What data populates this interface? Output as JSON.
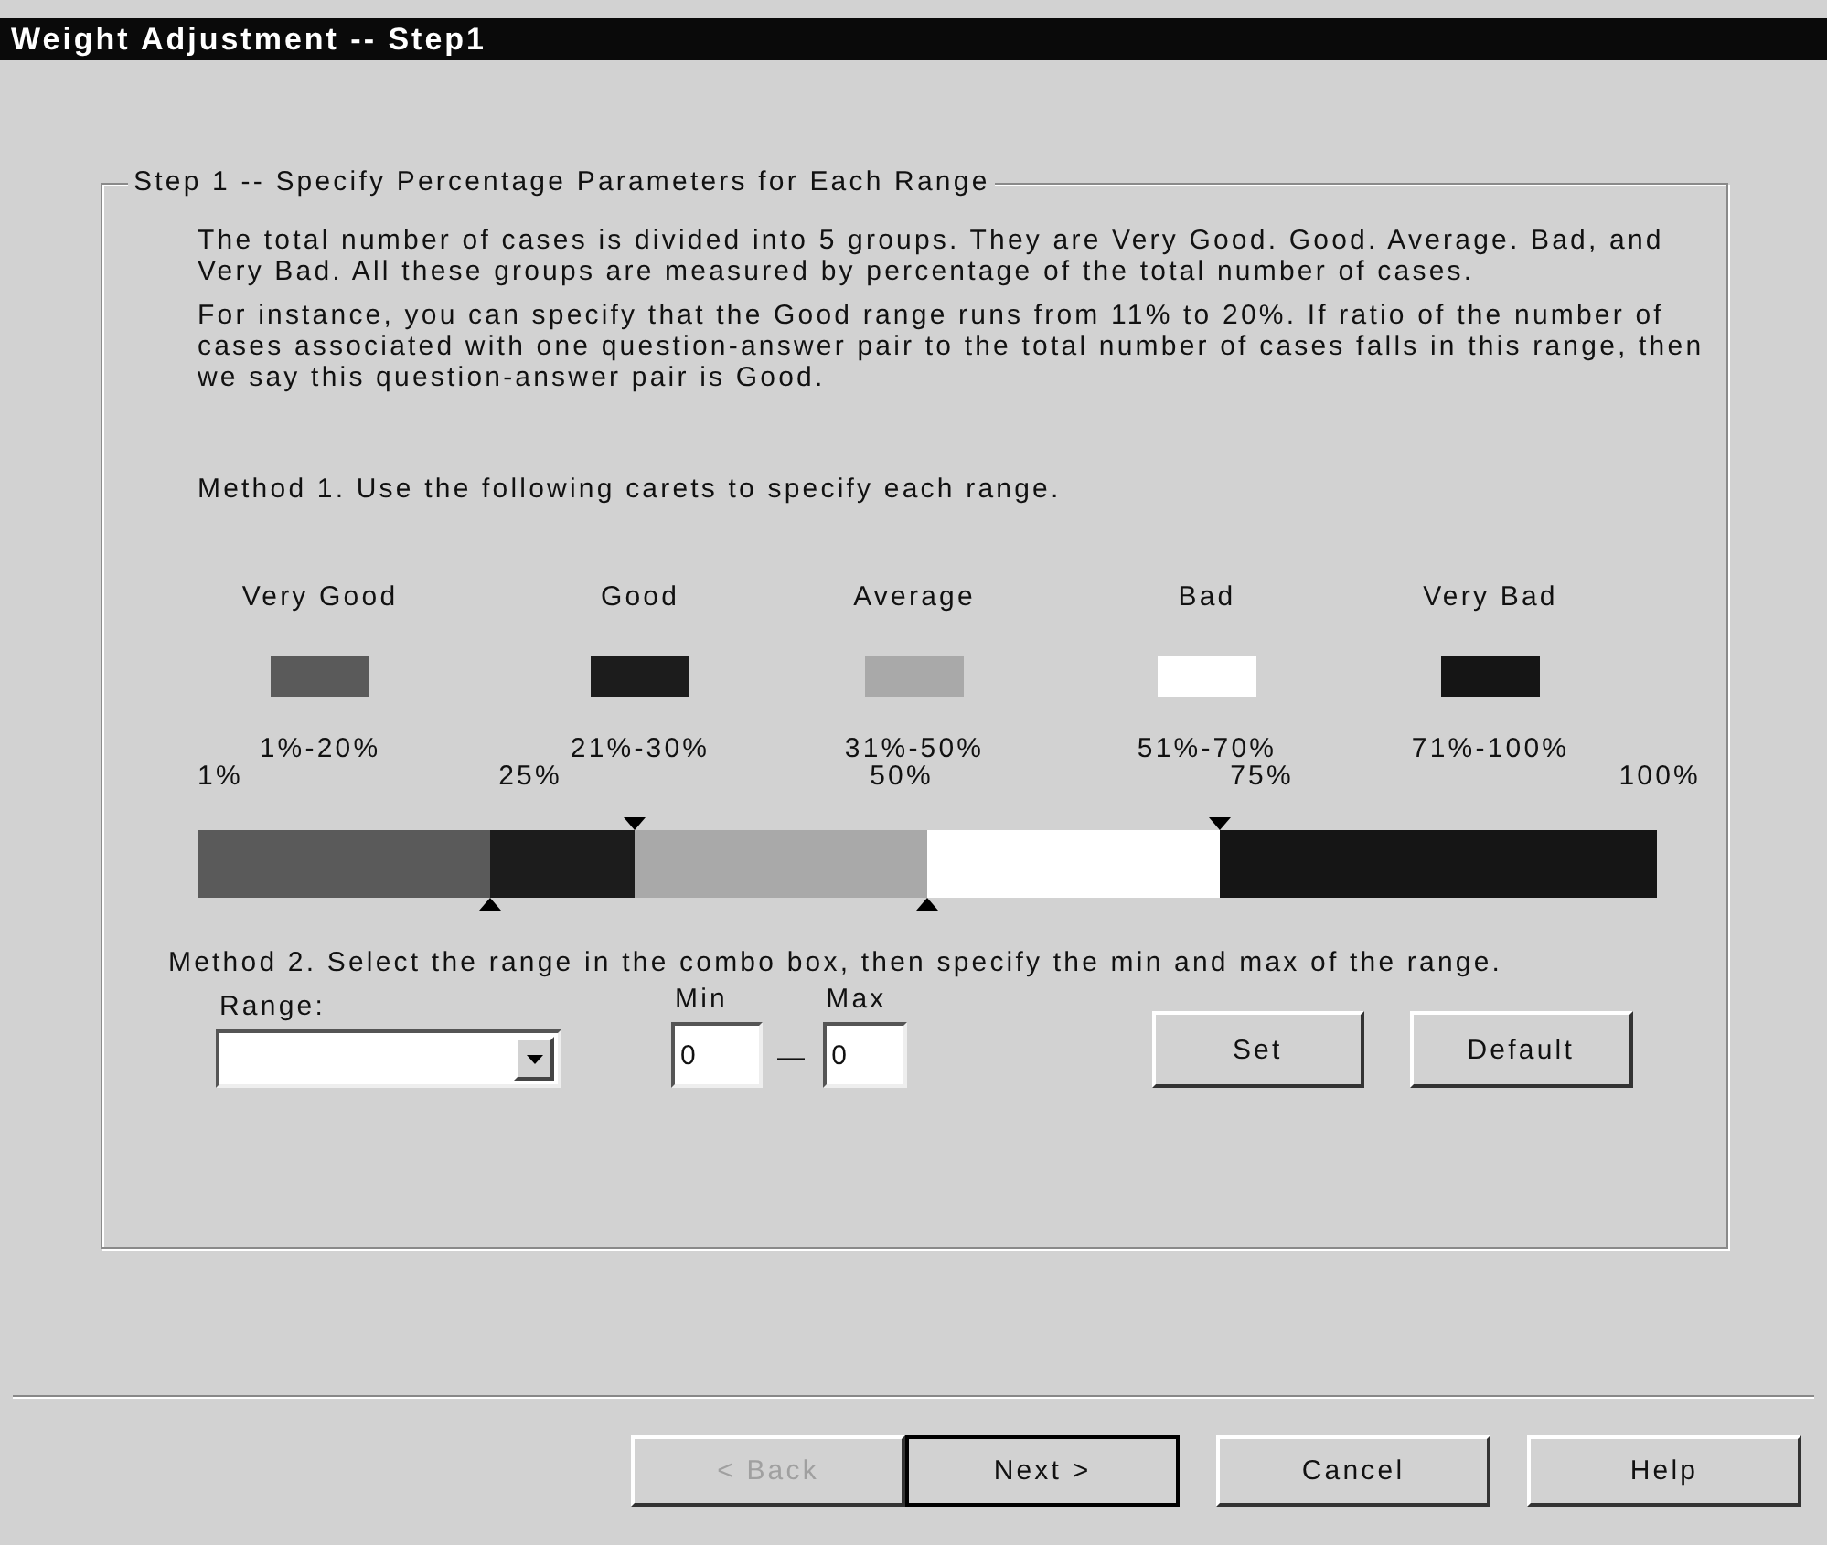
{
  "window": {
    "title": "Weight Adjustment -- Step1"
  },
  "group": {
    "title": "Step 1 -- Specify Percentage Parameters for Each Range",
    "paragraphs": [
      "The total number of cases is divided into 5 groups. They are Very Good. Good. Average. Bad, and Very Bad. All these groups are measured by percentage of the total number of cases.",
      "For instance, you can specify that the Good range runs from 11% to 20%. If ratio of the number of cases associated with one question-answer pair to the total  number of cases falls in this range, then we say this question-answer pair is Good."
    ],
    "method1": "Method 1. Use the following carets to specify each range.",
    "ranges": [
      {
        "label": "Very Good",
        "color": "#5a5a5a",
        "range": "1%-20%"
      },
      {
        "label": "Good",
        "color": "#1c1c1c",
        "range": "21%-30%"
      },
      {
        "label": "Average",
        "color": "#a9a9a9",
        "range": "31%-50%"
      },
      {
        "label": "Bad",
        "color": "#ffffff",
        "range": "51%-70%"
      },
      {
        "label": "Very Bad",
        "color": "#151515",
        "range": "71%-100%"
      }
    ],
    "scale": [
      "1%",
      "25%",
      "50%",
      "75%",
      "100%"
    ],
    "carets": [
      {
        "kind": "bottom",
        "level": 0.2
      },
      {
        "kind": "top",
        "level": 0.3
      },
      {
        "kind": "bottom",
        "level": 0.5
      },
      {
        "kind": "top",
        "level": 0.7
      }
    ],
    "method2": "Method 2. Select the range in the combo box, then specify the min and max of the range.",
    "range_label": "Range:",
    "min_label": "Min",
    "max_label": "Max",
    "min_value": "0",
    "dash": "—",
    "max_value": "0",
    "buttons": [
      {
        "label": "Set"
      },
      {
        "label": "Default"
      }
    ]
  },
  "footer_buttons": [
    {
      "label": "< Back",
      "disabled": true,
      "default": false
    },
    {
      "label": "Next >",
      "disabled": false,
      "default": true
    },
    {
      "label": "Cancel",
      "disabled": false,
      "default": false
    },
    {
      "label": "Help",
      "disabled": false,
      "default": false
    }
  ]
}
